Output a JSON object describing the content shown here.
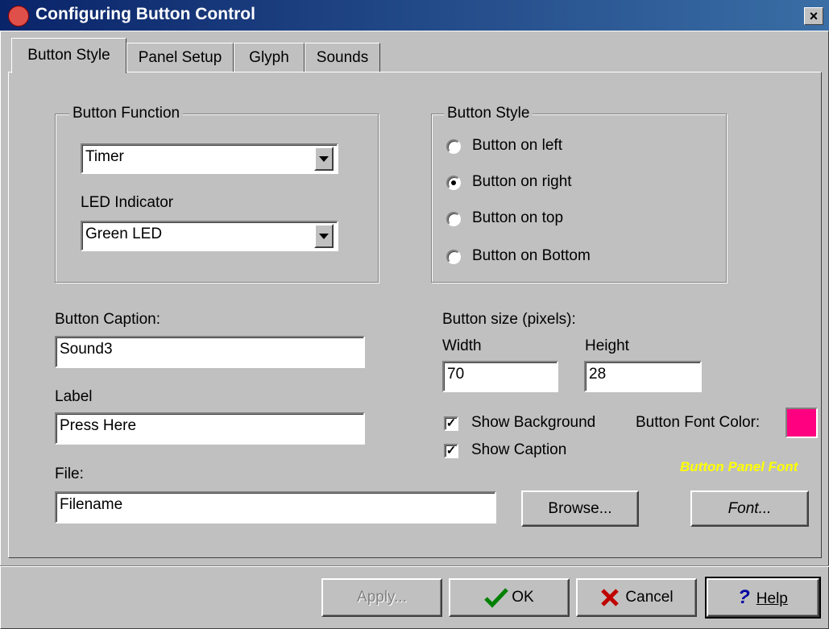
{
  "window": {
    "title": "Configuring Button Control",
    "close_glyph": "×"
  },
  "tabs": [
    {
      "label": "Button Style",
      "active": true
    },
    {
      "label": "Panel Setup",
      "active": false
    },
    {
      "label": "Glyph",
      "active": false
    },
    {
      "label": "Sounds",
      "active": false
    }
  ],
  "button_function": {
    "group_label": "Button Function",
    "function_value": "Timer",
    "led_label": "LED Indicator",
    "led_value": "Green LED"
  },
  "button_style": {
    "group_label": "Button Style",
    "options": [
      {
        "label": "Button on left",
        "selected": false
      },
      {
        "label": "Button on right",
        "selected": true
      },
      {
        "label": "Button on top",
        "selected": false
      },
      {
        "label": "Button on Bottom",
        "selected": false
      }
    ]
  },
  "caption": {
    "label": "Button Caption:",
    "value": "Sound3"
  },
  "label_field": {
    "label": "Label",
    "value": "Press Here"
  },
  "file": {
    "label": "File:",
    "value": "Filename",
    "browse_label": "Browse..."
  },
  "size": {
    "label": "Button size (pixels):",
    "width_label": "Width",
    "width_value": "70",
    "height_label": "Height",
    "height_value": "28"
  },
  "options": {
    "show_background_label": "Show Background",
    "show_background": true,
    "show_caption_label": "Show Caption",
    "show_caption": true
  },
  "font_color": {
    "label": "Button Font Color:",
    "color": "#ff0080"
  },
  "panel_font": {
    "preview_text": "Button Panel Font",
    "preview_color": "#ffff00",
    "font_button_label": "Font..."
  },
  "footer": {
    "apply_label": "Apply...",
    "ok_label": "OK",
    "cancel_label": "Cancel",
    "help_label": "Help"
  },
  "icons": {
    "ok": "checkmark-icon",
    "cancel": "x-icon",
    "help": "question-icon",
    "title": "app-icon"
  }
}
